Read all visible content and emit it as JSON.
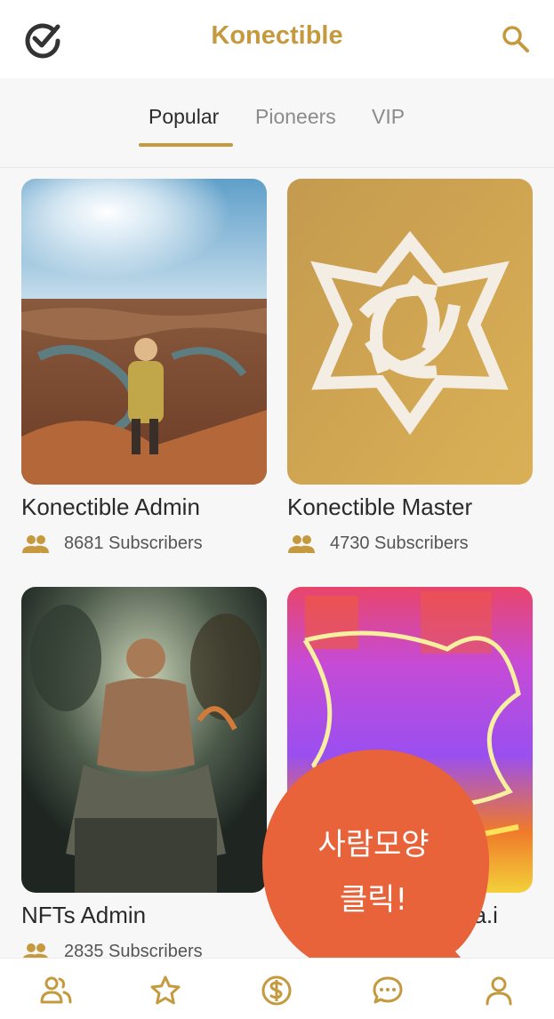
{
  "app": {
    "title": "Konectible",
    "brand_color": "#c59a3f"
  },
  "icons": {
    "logo": "check-circle-icon",
    "search": "search-icon",
    "subscribers": "people-icon"
  },
  "tabs": [
    {
      "label": "Popular",
      "active": true
    },
    {
      "label": "Pioneers",
      "active": false
    },
    {
      "label": "VIP",
      "active": false
    }
  ],
  "cards": [
    {
      "title": "Konectible Admin",
      "subscribers": "8681 Subscribers",
      "image": "canyon-hiker-photo"
    },
    {
      "title": "Konectible Master",
      "subscribers": "4730 Subscribers",
      "image": "gold-star-emblem"
    },
    {
      "title": "NFTs Admin",
      "subscribers": "2835 Subscribers",
      "image": "throne-warrior-art"
    },
    {
      "title": "ea.i",
      "subscribers": "",
      "image": "neon-abstract-art"
    }
  ],
  "bottom_nav": [
    {
      "icon": "people-icon"
    },
    {
      "icon": "star-icon"
    },
    {
      "icon": "dollar-icon"
    },
    {
      "icon": "chat-icon"
    },
    {
      "icon": "person-icon"
    }
  ],
  "callout": {
    "line1": "사람모양",
    "line2": "클릭!",
    "color": "#e8623a"
  }
}
